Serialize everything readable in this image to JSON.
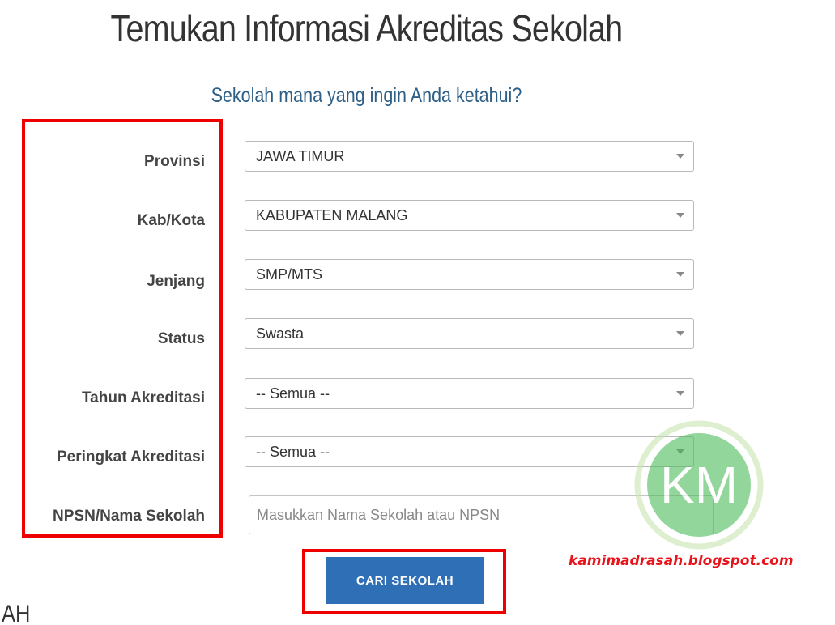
{
  "header": {
    "title": "Temukan Informasi Akreditas Sekolah",
    "subtitle": "Sekolah mana yang ingin Anda ketahui?"
  },
  "form": {
    "provinsi": {
      "label": "Provinsi",
      "value": "JAWA TIMUR"
    },
    "kabkota": {
      "label": "Kab/Kota",
      "value": "KABUPATEN MALANG"
    },
    "jenjang": {
      "label": "Jenjang",
      "value": "SMP/MTS"
    },
    "status": {
      "label": "Status",
      "value": "Swasta"
    },
    "tahun": {
      "label": "Tahun Akreditasi",
      "value": "-- Semua --"
    },
    "peringkat": {
      "label": "Peringkat Akreditasi",
      "value": "-- Semua --"
    },
    "npsn": {
      "label": "NPSN/Nama Sekolah",
      "value": "",
      "placeholder": "Masukkan Nama Sekolah atau NPSN"
    },
    "submit_label": "CARI SEKOLAH"
  },
  "overlay": {
    "watermark": "kamimadrasah.blogspot.com",
    "logo_text": "KM",
    "highlight_color": "#ee0000",
    "logo_color": "#5cc36a"
  },
  "cutoff_text": "AH",
  "colors": {
    "button": "#2f6fb5",
    "subtitle": "#2e5f86",
    "watermark": "#e8141c"
  }
}
